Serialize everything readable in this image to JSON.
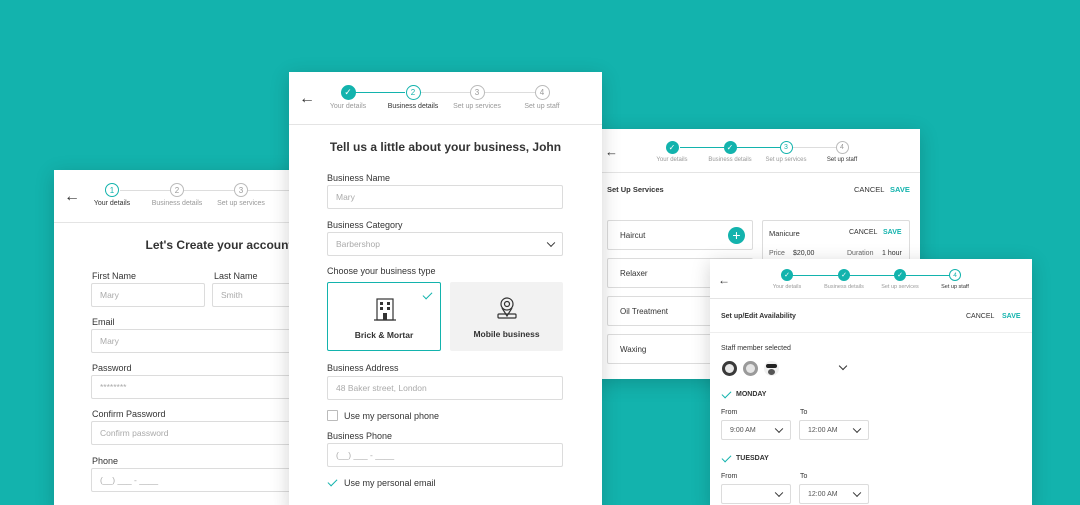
{
  "colors": {
    "background": "#13b3ad",
    "accent": "#13b3ad"
  },
  "card1": {
    "steps": [
      {
        "num": "1",
        "label": "Your details"
      },
      {
        "num": "2",
        "label": "Business details"
      },
      {
        "num": "3",
        "label": "Set up services"
      }
    ],
    "title": "Let's Create your account",
    "first_name_label": "First Name",
    "first_name_placeholder": "Mary",
    "last_name_label": "Last Name",
    "last_name_placeholder": "Smith",
    "email_label": "Email",
    "email_placeholder": "Mary",
    "password_label": "Password",
    "password_placeholder": "********",
    "confirm_label": "Confirm Password",
    "confirm_placeholder": "Confirm password",
    "phone_label": "Phone",
    "phone_placeholder": "(__) ___ - ____"
  },
  "card2": {
    "steps": [
      {
        "num": "",
        "label": "Your details"
      },
      {
        "num": "2",
        "label": "Business details"
      },
      {
        "num": "3",
        "label": "Set up services"
      },
      {
        "num": "4",
        "label": "Set up staff"
      }
    ],
    "title": "Tell us a little about your business, John",
    "business_name_label": "Business Name",
    "business_name_placeholder": "Mary",
    "category_label": "Business Category",
    "category_value": "Barbershop",
    "type_label": "Choose your business type",
    "type_brick": "Brick & Mortar",
    "type_mobile": "Mobile business",
    "address_label": "Business Address",
    "address_placeholder": "48 Baker street, London",
    "personal_phone": "Use my personal phone",
    "phone_label": "Business Phone",
    "phone_placeholder": "(__) ___ - ____",
    "personal_email": "Use my personal email"
  },
  "card3": {
    "steps": [
      {
        "num": "",
        "label": "Your details"
      },
      {
        "num": "",
        "label": "Business details"
      },
      {
        "num": "3",
        "label": "Set up services"
      },
      {
        "num": "4",
        "label": "Set up staff"
      }
    ],
    "title": "Set Up Services",
    "cancel": "CANCEL",
    "save": "SAVE",
    "services": [
      "Haircut",
      "Relaxer",
      "Oil Treatment",
      "Waxing"
    ],
    "edit": {
      "name": "Manicure",
      "cancel": "CANCEL",
      "save": "SAVE",
      "price_label": "Price",
      "price_value": "$20,00",
      "duration_label": "Duration",
      "duration_value": "1 hour"
    }
  },
  "card4": {
    "steps": [
      {
        "num": "",
        "label": "Your details"
      },
      {
        "num": "",
        "label": "Business details"
      },
      {
        "num": "",
        "label": "Set up services"
      },
      {
        "num": "4",
        "label": "Set up staff"
      }
    ],
    "title": "Set up/Edit Availability",
    "cancel": "CANCEL",
    "save": "SAVE",
    "staff_label": "Staff member selected",
    "day1": "MONDAY",
    "day2": "TUESDAY",
    "from_label": "From",
    "to_label": "To",
    "from_value": "9:00 AM",
    "to_value": "12:00 AM"
  }
}
